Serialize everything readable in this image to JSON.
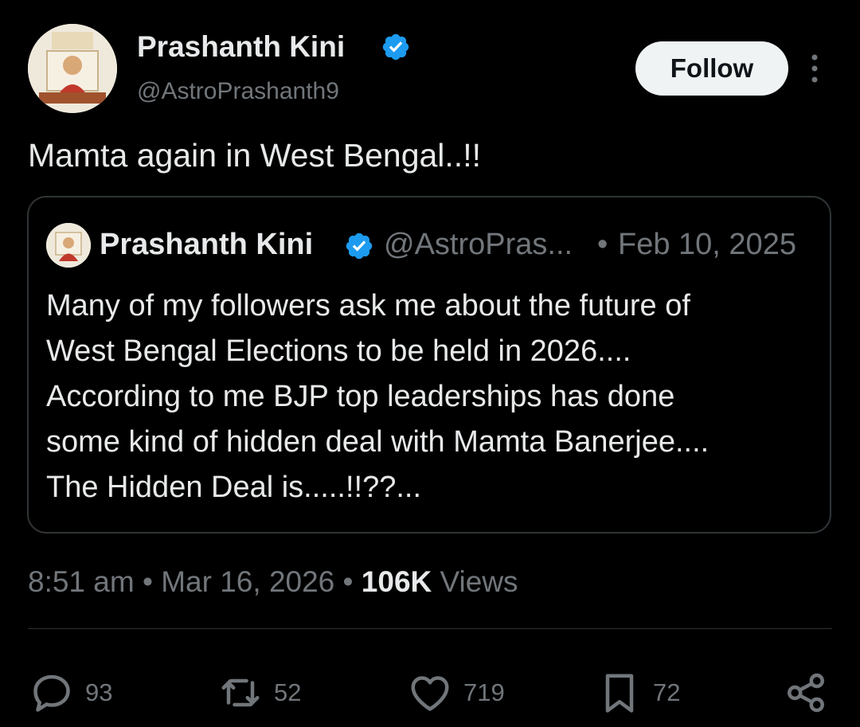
{
  "author": {
    "name": "Prashanth Kini",
    "handle": "@AstroPrashanth9",
    "avatar_icon": "profile-photo",
    "verified_color": "#1d9bf0"
  },
  "follow_label": "Follow",
  "more_icon": "more-vertical-icon",
  "tweet_text": "Mamta again in West Bengal..!!",
  "quote": {
    "name": "Prashanth Kini",
    "handle": "@AstroPras...",
    "separator": "•",
    "date": "Feb 10, 2025",
    "lines": [
      "Many of my followers ask me about the future of",
      "West Bengal Elections to be held in 2026....",
      "According to me BJP top leaderships has done",
      "some kind of hidden deal with Mamta Banerjee....",
      "The Hidden Deal is.....!!??..."
    ]
  },
  "meta": {
    "time": "8:51 am",
    "separator": "•",
    "date": "Mar 16, 2026",
    "views_count": "106K",
    "views_label": "Views"
  },
  "actions": {
    "replies": "93",
    "reposts": "52",
    "likes": "719",
    "bookmarks": "72"
  },
  "colors": {
    "background": "#000000",
    "text": "#e7e9ea",
    "secondary": "#71767b",
    "border": "#2f3336",
    "verified": "#1d9bf0",
    "follow_bg": "#eff3f4"
  }
}
